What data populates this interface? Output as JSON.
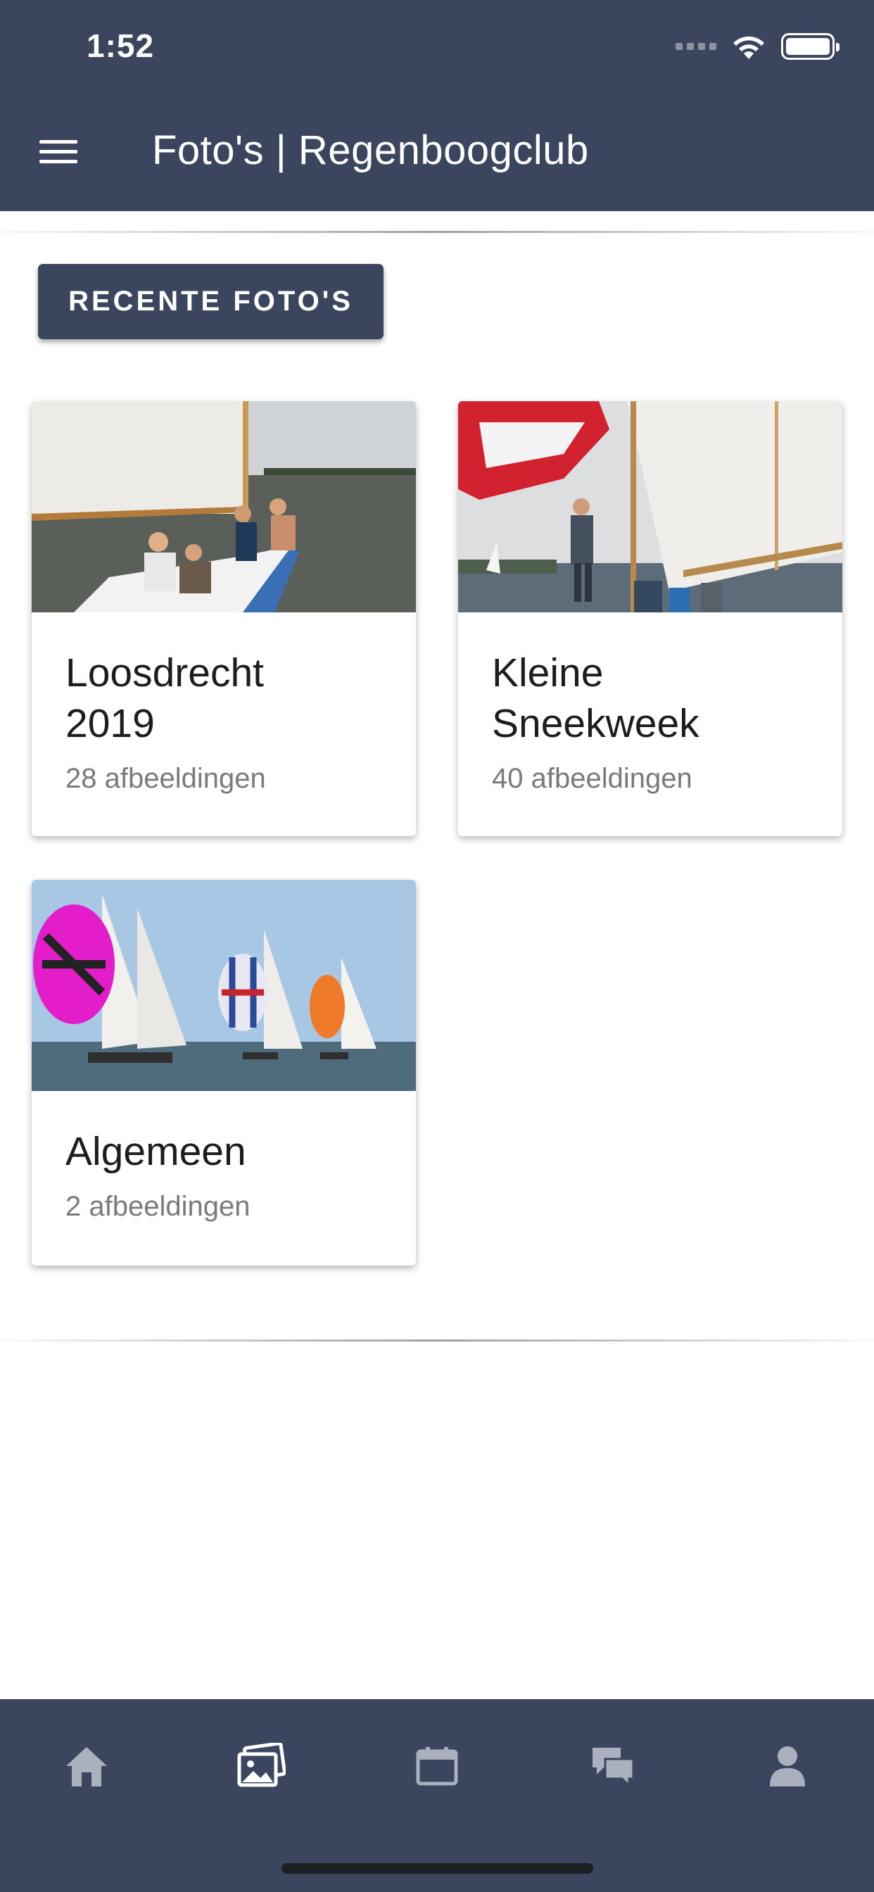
{
  "status_bar": {
    "time": "1:52"
  },
  "header": {
    "title": "Foto's | Regenboogclub",
    "menu_icon": "hamburger-menu-icon"
  },
  "main": {
    "recent_button_label": "RECENTE FOTO'S",
    "albums": [
      {
        "title": "Loosdrecht 2019",
        "count": "28 afbeeldingen"
      },
      {
        "title": "Kleine Sneekweek",
        "count": "40 afbeeldingen"
      },
      {
        "title": "Algemeen",
        "count": "2 afbeeldingen"
      }
    ]
  },
  "tabbar": {
    "tabs": [
      {
        "icon": "home-icon",
        "active": false
      },
      {
        "icon": "photos-icon",
        "active": true
      },
      {
        "icon": "calendar-icon",
        "active": false
      },
      {
        "icon": "chat-icon",
        "active": false
      },
      {
        "icon": "profile-icon",
        "active": false
      }
    ]
  },
  "colors": {
    "primary": "#3b455d",
    "inactive_icon": "#aab0bd",
    "active_icon": "#ffffff"
  }
}
